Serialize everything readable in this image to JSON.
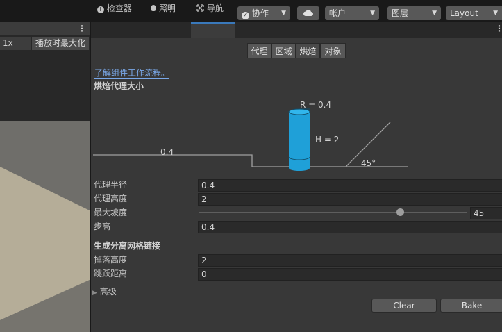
{
  "toolbar": {
    "collab_label": "协作",
    "account_label": "帐户",
    "layers_label": "图层",
    "layout_label": "Layout"
  },
  "scene_view": {
    "scale_label": "1x",
    "maximize_on_play": "播放时最大化"
  },
  "tabs": [
    {
      "label": "检查器"
    },
    {
      "label": "照明"
    },
    {
      "label": "导航"
    }
  ],
  "nav_segments": [
    {
      "label": "代理",
      "active": false
    },
    {
      "label": "区域",
      "active": false
    },
    {
      "label": "烘焙",
      "active": true
    },
    {
      "label": "对象",
      "active": false
    }
  ],
  "help_link": "了解组件工作流程。",
  "bake_agent_header": "烘焙代理大小",
  "diagram": {
    "radius_label": "R = 0.4",
    "height_label": "H = 2",
    "step_label": "0.4",
    "slope_label": "45°"
  },
  "fields": {
    "agent_radius": {
      "label": "代理半径",
      "value": "0.4"
    },
    "agent_height": {
      "label": "代理高度",
      "value": "2"
    },
    "max_slope": {
      "label": "最大坡度",
      "value": "45",
      "slider_fraction": 0.75
    },
    "step_height": {
      "label": "步高",
      "value": "0.4"
    }
  },
  "offmesh_header": "生成分离网格链接",
  "offmesh_fields": {
    "drop_height": {
      "label": "掉落高度",
      "value": "2"
    },
    "jump_distance": {
      "label": "跳跃距离",
      "value": "0"
    }
  },
  "advanced_label": "高级",
  "buttons": {
    "clear": "Clear",
    "bake": "Bake"
  },
  "colors": {
    "accent_blue": "#3a79bb",
    "cylinder": "#1fa0d8",
    "link": "#7aa8e8"
  }
}
